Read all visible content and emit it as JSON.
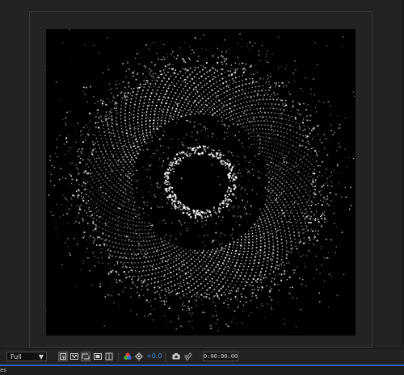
{
  "viewer": {
    "resolution": "Full",
    "exposure": "+0.0",
    "timecode": "0:00:00:00"
  },
  "status": {
    "text": "es"
  },
  "colors": {
    "accent": "#2e63b8",
    "exposure_text": "#3f8de0",
    "canvas": "#000000",
    "panel": "#232323"
  },
  "icons": [
    "region-of-interest-icon",
    "transparency-grid-icon",
    "mask-path-icon",
    "title-action-safe-icon",
    "color-channels-icon",
    "exposure-reset-icon",
    "snapshot-camera-icon",
    "show-snapshot-icon"
  ]
}
